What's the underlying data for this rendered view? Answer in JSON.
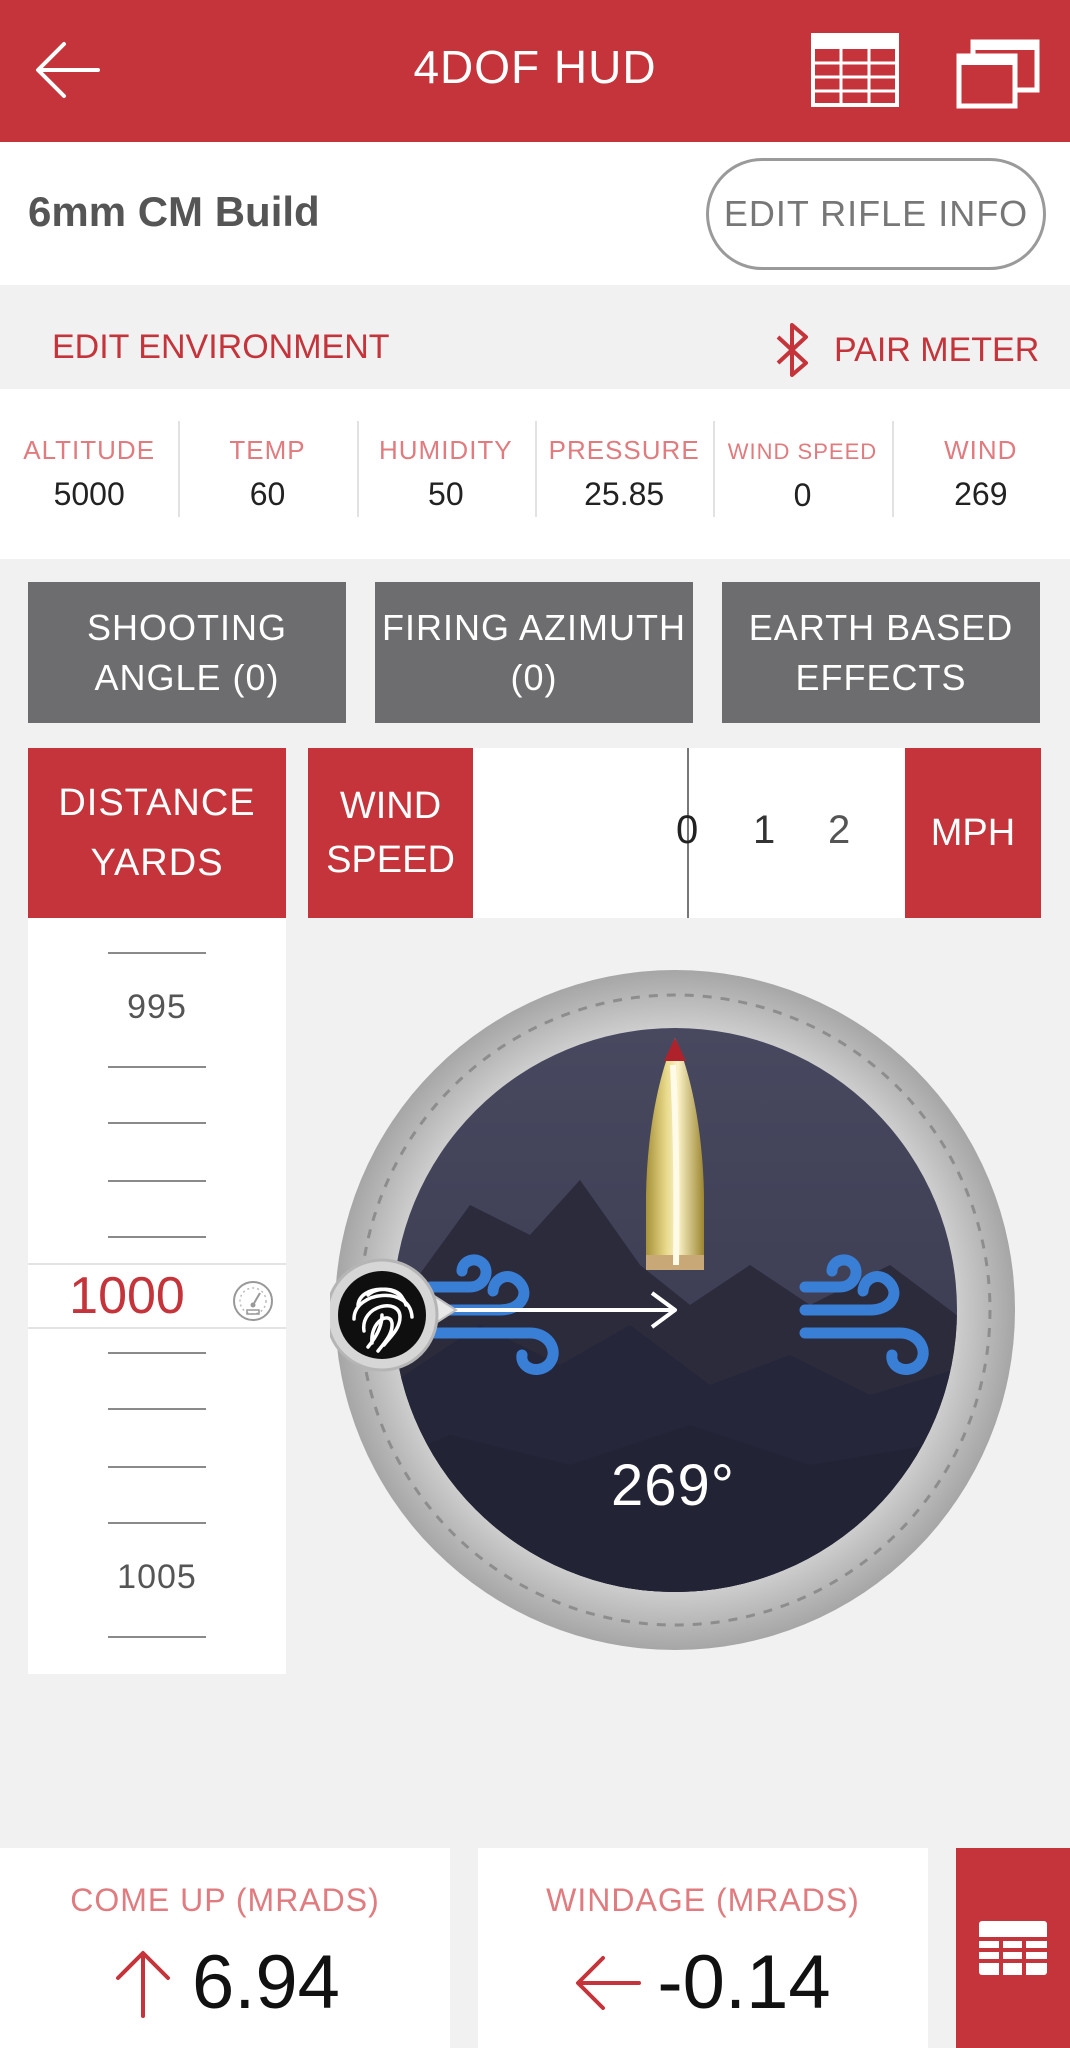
{
  "header": {
    "title": "4DOF HUD",
    "back_icon": "arrow-left-icon",
    "table_icon": "table-icon",
    "windows_icon": "copy-windows-icon",
    "color": "#c4343a"
  },
  "rifle": {
    "name": "6mm CM Build",
    "edit_label": "EDIT RIFLE INFO"
  },
  "environment": {
    "edit_label": "EDIT ENVIRONMENT",
    "pair_label": "PAIR METER",
    "pair_icon": "bluetooth-icon",
    "stats": [
      {
        "label": "ALTITUDE",
        "value": "5000"
      },
      {
        "label": "TEMP",
        "value": "60"
      },
      {
        "label": "HUMIDITY",
        "value": "50"
      },
      {
        "label": "PRESSURE",
        "value": "25.85"
      },
      {
        "label": "WIND SPEED",
        "value": "0"
      },
      {
        "label": "WIND",
        "value": "269"
      }
    ]
  },
  "buttons": {
    "shooting_angle_l1": "SHOOTING",
    "shooting_angle_l2": "ANGLE (0)",
    "firing_azimuth_l1": "FIRING AZIMUTH",
    "firing_azimuth_l2": "(0)",
    "earth_effects_l1": "EARTH BASED",
    "earth_effects_l2": "EFFECTS"
  },
  "distance": {
    "head_l1": "DISTANCE",
    "head_l2": "YARDS",
    "prev": "995",
    "selected": "1000",
    "next": "1005",
    "gauge_icon": "gauge-icon"
  },
  "wind_speed": {
    "head_l1": "WIND",
    "head_l2": "SPEED",
    "scale": [
      "0",
      "1",
      "2"
    ],
    "unit": "MPH"
  },
  "compass": {
    "direction": "269°",
    "direction_value": 269,
    "wind_icon": "wind-icon",
    "touch_icon": "fingerprint-icon",
    "bullet_icon": "bullet-icon"
  },
  "results": {
    "come_up_label": "COME UP (MRADS)",
    "come_up_value": "6.94",
    "come_up_icon": "arrow-up-icon",
    "windage_label": "WINDAGE (MRADS)",
    "windage_value": "-0.14",
    "windage_icon": "arrow-left-icon",
    "calc_icon": "table-icon"
  }
}
